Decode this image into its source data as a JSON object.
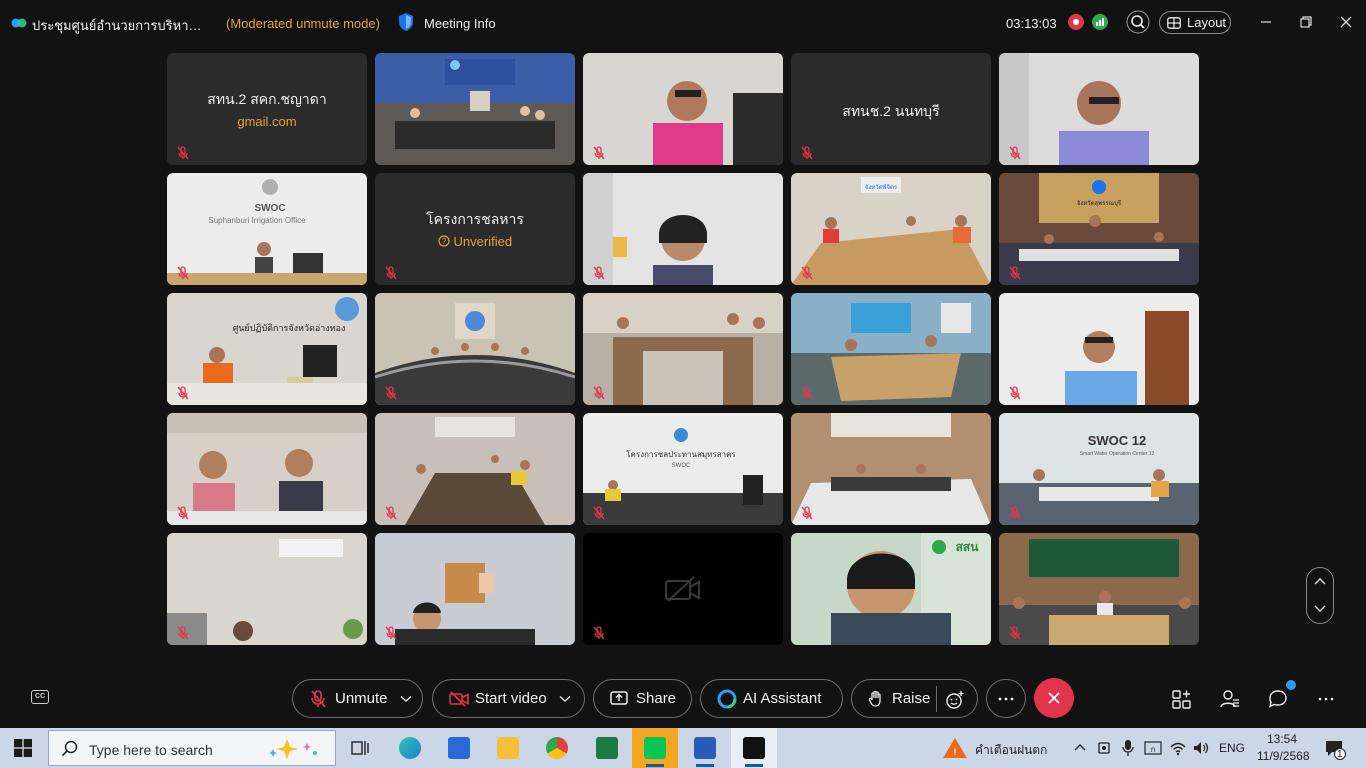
{
  "titlebar": {
    "meeting_title": "ประชุมศูนย์อำนวยการบริหารจัดการน้ำ",
    "mode": "(Moderated unmute mode)",
    "meeting_info": "Meeting Info",
    "timer": "03:13:03",
    "layout_label": "Layout"
  },
  "tiles": [
    {
      "name": "สทน.2 สคก.ชญาดา",
      "sub": "gmail.com"
    },
    {
      "name": "สทนช.2 นนทบุรี",
      "sub": ""
    },
    {
      "name": "โครงการชลหาร",
      "sub": "Unverified"
    }
  ],
  "scene_text": {
    "swoc_title": "SWOC",
    "swoc_sub": "Suphanburi Irrigation Office",
    "ops_center": "ศูนย์ปฏิบัติการจังหวัดอ่างทอง",
    "project_sign": "โครงการชลประทานสมุทรสาคร",
    "project_sign_sub": "SWOC",
    "swoc12": "SWOC 12",
    "swoc12_sub": "Smart Water Operation Center 12",
    "ssn_logo": "สสน",
    "phichit": "จังหวัดพิจิตร",
    "suphan": "จังหวัดสุพรรณบุรี"
  },
  "toolbar": {
    "unmute": "Unmute",
    "start_video": "Start video",
    "share": "Share",
    "ai_assistant": "AI Assistant",
    "raise": "Raise"
  },
  "taskbar": {
    "search_placeholder": "Type here to search",
    "weather": "คำเตือนฝนตก",
    "lang": "ENG",
    "time": "13:54",
    "date": "11/9/2568",
    "notif_count": "1"
  },
  "colors": {
    "accent_orange": "#e8a33b",
    "leave_red": "#e2354d",
    "tile_bg": "#2b2b2b",
    "background": "#121212"
  }
}
